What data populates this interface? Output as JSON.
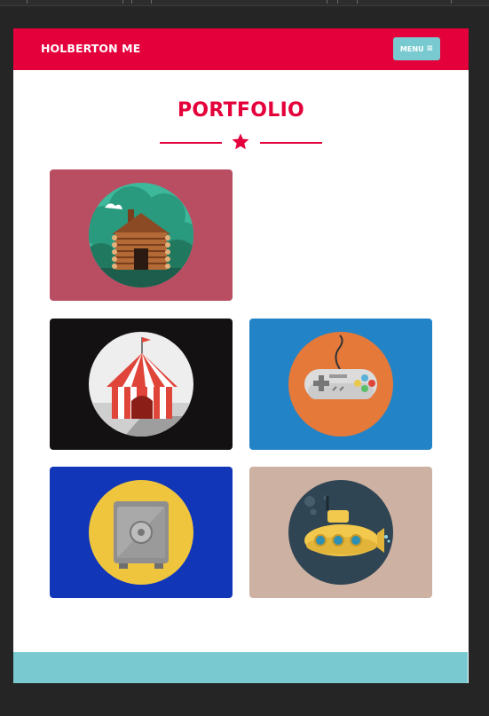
{
  "navbar": {
    "brand": "HOLBERTON ME",
    "menu_label": "MENU"
  },
  "portfolio": {
    "title": "PORTFOLIO",
    "items": [
      {
        "name": "cabin",
        "bg": "#b94e63"
      },
      {
        "name": "circus-tent",
        "bg": "#131111"
      },
      {
        "name": "game-controller",
        "bg": "#2283c6"
      },
      {
        "name": "safe",
        "bg": "#1136b8"
      },
      {
        "name": "submarine",
        "bg": "#cdb1a2"
      }
    ]
  },
  "colors": {
    "accent": "#e4003b",
    "teal": "#78cad0"
  }
}
